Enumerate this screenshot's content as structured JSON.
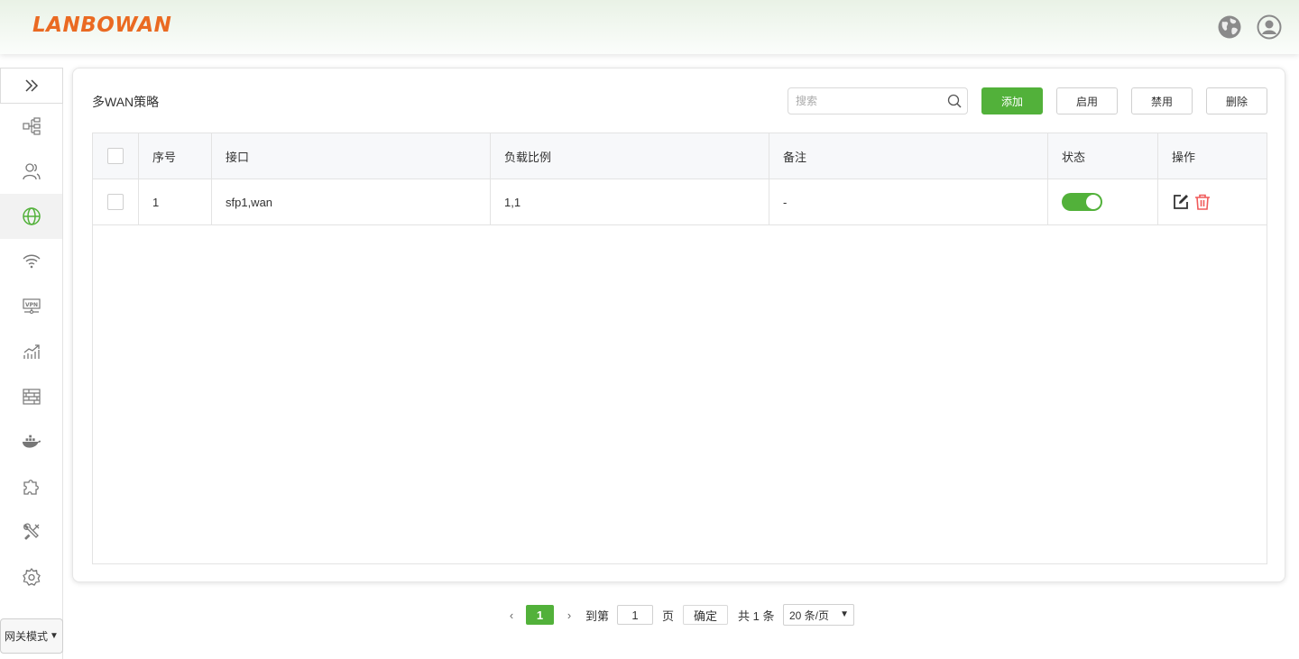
{
  "header": {
    "logo": "LANBOWAN",
    "globe_icon": "globe-icon",
    "user_icon": "user-avatar-icon"
  },
  "sidebar": {
    "collapse_icon": "double-chevron-right-icon",
    "items": [
      {
        "name": "network-topology",
        "icon": "network-topology-icon",
        "active": false
      },
      {
        "name": "users",
        "icon": "users-icon",
        "active": false
      },
      {
        "name": "internet",
        "icon": "globe-icon",
        "active": true
      },
      {
        "name": "wifi",
        "icon": "wifi-icon",
        "active": false
      },
      {
        "name": "vpn",
        "icon": "vpn-icon",
        "active": false
      },
      {
        "name": "traffic",
        "icon": "chart-icon",
        "active": false
      },
      {
        "name": "firewall",
        "icon": "firewall-icon",
        "active": false
      },
      {
        "name": "docker",
        "icon": "docker-icon",
        "active": false
      },
      {
        "name": "plugins",
        "icon": "puzzle-icon",
        "active": false
      },
      {
        "name": "tools",
        "icon": "tools-icon",
        "active": false
      },
      {
        "name": "settings",
        "icon": "gear-icon",
        "active": false
      }
    ],
    "mode_select": "网关模式"
  },
  "main": {
    "title": "多WAN策略",
    "search_placeholder": "搜索",
    "buttons": {
      "add": "添加",
      "enable": "启用",
      "disable": "禁用",
      "delete": "删除"
    },
    "table": {
      "columns": {
        "no": "序号",
        "interface": "接口",
        "load_ratio": "负载比例",
        "note": "备注",
        "status": "状态",
        "actions": "操作"
      },
      "rows": [
        {
          "no": "1",
          "interface": "sfp1,wan",
          "load_ratio": "1,1",
          "note": "-",
          "status_on": true
        }
      ]
    }
  },
  "pagination": {
    "prev": "‹",
    "current": "1",
    "next": "›",
    "goto_label": "到第",
    "page_input": "1",
    "page_label": "页",
    "confirm": "确定",
    "total": "共 1 条",
    "page_size": "20 条/页"
  },
  "colors": {
    "accent": "#52b13a",
    "logo": "#ea6a22",
    "delete": "#f05a5a"
  }
}
